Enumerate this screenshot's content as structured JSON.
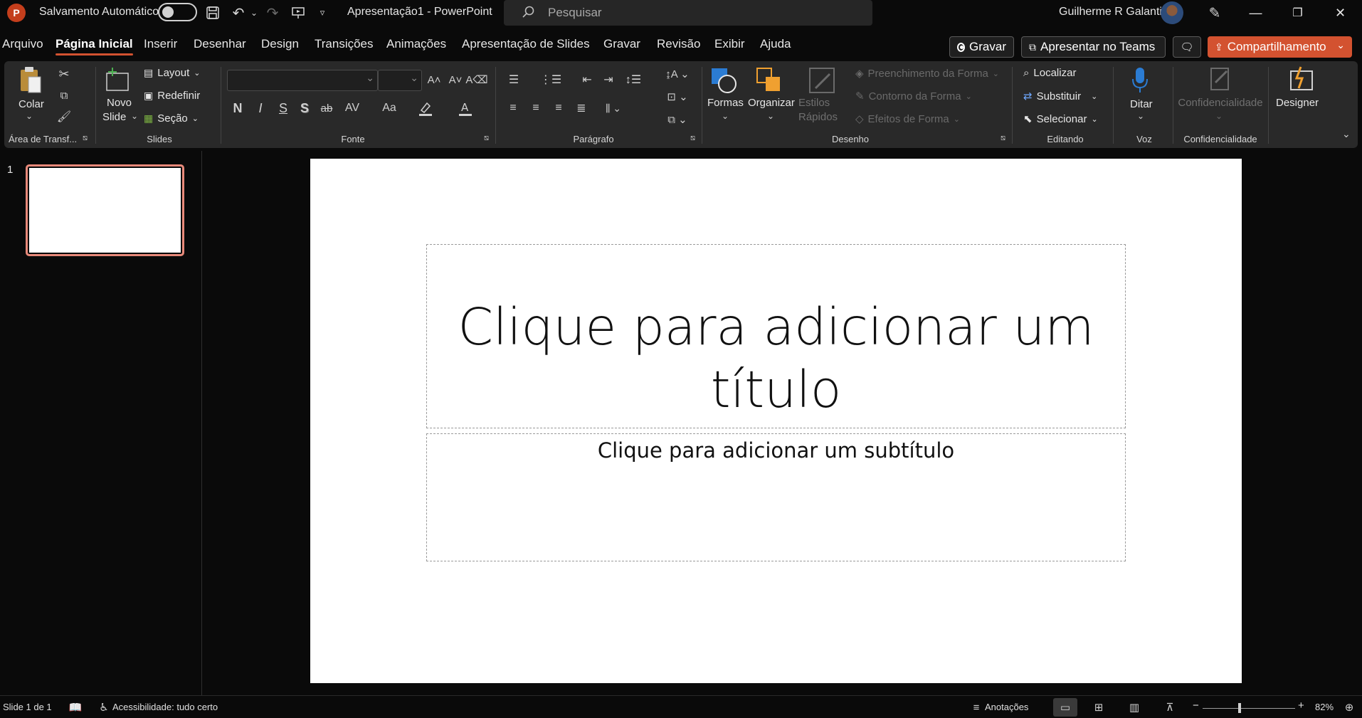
{
  "titlebar": {
    "autosave_label": "Salvamento Automático",
    "doc_title": "Apresentação1  -  PowerPoint",
    "search_placeholder": "Pesquisar",
    "user_name": "Guilherme R Galanti",
    "app_badge": "P"
  },
  "tabs": [
    "Arquivo",
    "Página Inicial",
    "Inserir",
    "Desenhar",
    "Design",
    "Transições",
    "Animações",
    "Apresentação de Slides",
    "Gravar",
    "Revisão",
    "Exibir",
    "Ajuda"
  ],
  "active_tab": "Página Inicial",
  "actions": {
    "record": "Gravar",
    "teams": "Apresentar no Teams",
    "share": "Compartilhamento"
  },
  "ribbon": {
    "clipboard": {
      "paste": "Colar",
      "group": "Área de Transf..."
    },
    "slides": {
      "new_slide_1": "Novo",
      "new_slide_2": "Slide",
      "layout": "Layout",
      "reset": "Redefinir",
      "section": "Seção",
      "group": "Slides"
    },
    "font": {
      "bold": "N",
      "italic": "I",
      "underline": "S",
      "shadow": "S",
      "strike": "ab",
      "spacing": "AV",
      "case": "Aa",
      "group": "Fonte"
    },
    "paragraph": {
      "group": "Parágrafo"
    },
    "drawing": {
      "shapes": "Formas",
      "arrange": "Organizar",
      "quick_styles_1": "Estilos",
      "quick_styles_2": "Rápidos",
      "fill": "Preenchimento da Forma",
      "outline": "Contorno da Forma",
      "effects": "Efeitos de Forma",
      "group": "Desenho"
    },
    "editing": {
      "find": "Localizar",
      "replace": "Substituir",
      "select": "Selecionar",
      "group": "Editando"
    },
    "voice": {
      "dictate": "Ditar",
      "group": "Voz"
    },
    "sensitivity": {
      "label": "Confidencialidade",
      "group": "Confidencialidade"
    },
    "designer": {
      "label": "Designer"
    }
  },
  "thumbnails": {
    "slide_number": "1"
  },
  "slide": {
    "title_line1": "Clique para adicionar um",
    "title_line2": "título",
    "subtitle": "Clique para adicionar um subtítulo"
  },
  "status": {
    "slide_info": "Slide 1 de 1",
    "accessibility": "Acessibilidade: tudo certo",
    "notes": "Anotações",
    "zoom_minus": "−",
    "zoom_plus": "+",
    "zoom": "82%"
  },
  "colors": {
    "accent": "#d35230",
    "ribbon_bg": "#292929",
    "app_bg": "#0a0a0a"
  }
}
